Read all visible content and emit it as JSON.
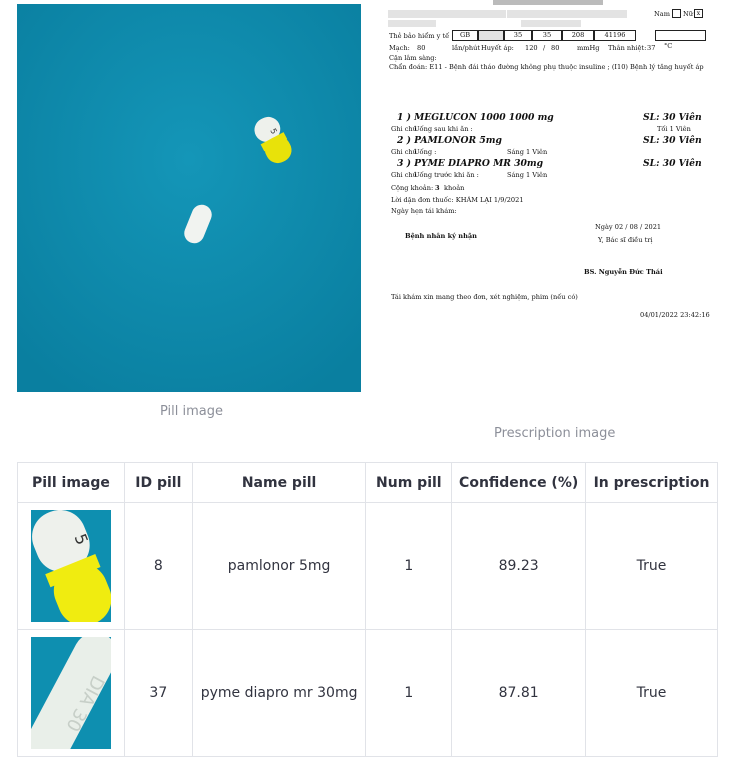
{
  "captions": {
    "pill_image": "Pill image",
    "prescription_image": "Prescription image"
  },
  "pill_photo": {
    "background": "#0d8fb1",
    "capsule_marking": "5"
  },
  "prescription": {
    "insurance_label": "Thẻ bảo hiểm y tế",
    "gender_male": "Nam",
    "gender_female": "Nữ",
    "gender_marked": "x",
    "card_cells": [
      "GB",
      "",
      "35",
      "35",
      "208",
      "41196"
    ],
    "vitals": {
      "pulse_label": "Mạch:",
      "pulse": "80",
      "pulse_unit": "lần/phút",
      "bp_label": "Huyết áp:",
      "bp_sys": "120",
      "bp_sep": "/",
      "bp_dia": "80",
      "bp_unit": "mmHg",
      "temp_label": "Thân nhiệt:",
      "temp": "37",
      "temp_unit": "°C"
    },
    "clinical_label": "Cận lâm sàng:",
    "diagnosis": "Chẩn đoán: E11 - Bệnh đái tháo đường không phụ thuộc insuline ; (I10) Bệnh lý tăng huyết áp",
    "medications": [
      {
        "line": "1 ) MEGLUCON 1000 1000 mg",
        "qty": "SL: 30 Viên",
        "note_label": "Ghi chú",
        "note": "Uống sau khi ăn :",
        "dose": "Tối 1 Viên"
      },
      {
        "line": "2 ) PAMLONOR 5mg",
        "qty": "SL: 30 Viên",
        "note_label": "Ghi chú",
        "note": "Uống :",
        "dose": "Sáng 1 Viên"
      },
      {
        "line": "3 ) PYME DIAPRO MR 30mg",
        "qty": "SL: 30 Viên",
        "note_label": "Ghi chú",
        "note": "Uống trước khi ăn :",
        "dose": "Sáng 1 Viên"
      }
    ],
    "total_label": "Cộng khoản:",
    "total_value": "3",
    "total_unit": "khoản",
    "advice": "Lời dặn đơn thuốc:  KHÁM LẠI 1/9/2021",
    "revisit": "Ngày hẹn tái khám:",
    "date_line": "Ngày 02 / 08 / 2021",
    "doctor_role": "Y, Bác sĩ điều trị",
    "patient_sign": "Bệnh nhân ký nhận",
    "doctor_name": "BS. Nguyễn Đức Thái",
    "footer_note": "Tái khám xin mang theo đơn, xét nghiệm, phim (nếu có)",
    "timestamp": "04/01/2022 23:42:16"
  },
  "table": {
    "headers": [
      "Pill image",
      "ID pill",
      "Name pill",
      "Num pill",
      "Confidence (%)",
      "In prescription"
    ],
    "rows": [
      {
        "id": "8",
        "name": "pamlonor 5mg",
        "num": "1",
        "confidence": "89.23",
        "in_prescription": "True",
        "thumb_marking": "5"
      },
      {
        "id": "37",
        "name": "pyme diapro mr 30mg",
        "num": "1",
        "confidence": "87.81",
        "in_prescription": "True",
        "thumb_marking": "DIA 30"
      }
    ]
  }
}
